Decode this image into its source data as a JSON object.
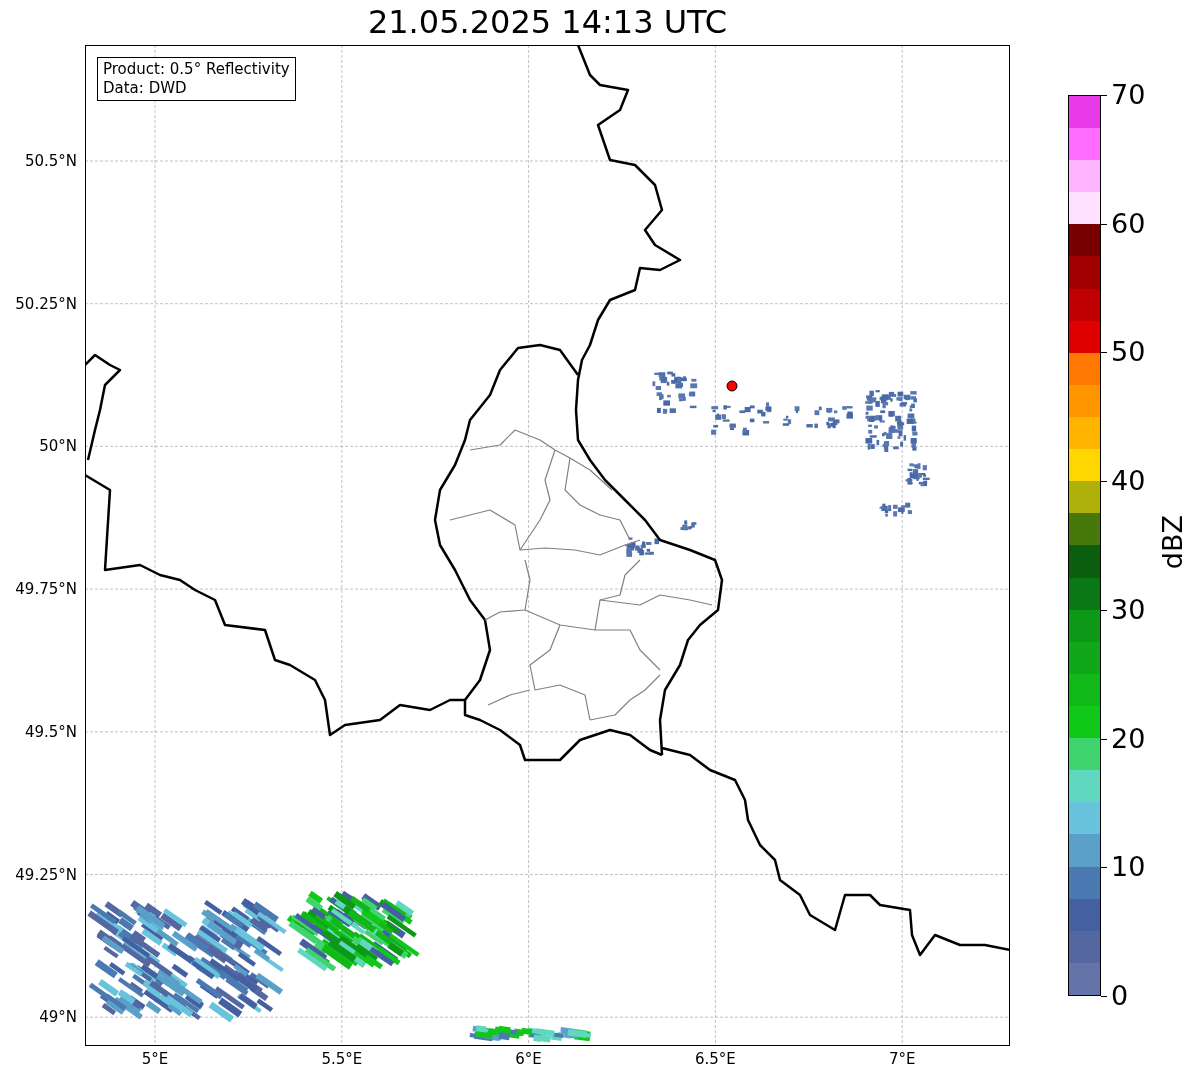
{
  "title": "21.05.2025 14:13 UTC",
  "info_box": {
    "lines": [
      "Product: 0.5° Reflectivity",
      "Data: DWD"
    ]
  },
  "map": {
    "y_ticks": [
      "50.5°N",
      "50.25°N",
      "50°N",
      "49.75°N",
      "49.5°N",
      "49.25°N",
      "49°N"
    ],
    "x_ticks": [
      "5°E",
      "5.5°E",
      "6°E",
      "6.5°E",
      "7°E"
    ]
  },
  "colorbar": {
    "label": "dBZ",
    "ticks": [
      "70",
      "60",
      "50",
      "40",
      "30",
      "20",
      "10",
      "0"
    ],
    "segments": [
      {
        "color": "#6474a8"
      },
      {
        "color": "#5567a0"
      },
      {
        "color": "#4460a0"
      },
      {
        "color": "#4b7ab3"
      },
      {
        "color": "#5aa0c8"
      },
      {
        "color": "#68c4dc"
      },
      {
        "color": "#60d8c0"
      },
      {
        "color": "#3fd46e"
      },
      {
        "color": "#10c818"
      },
      {
        "color": "#10b818"
      },
      {
        "color": "#10a818"
      },
      {
        "color": "#0e9818"
      },
      {
        "color": "#0a7814"
      },
      {
        "color": "#0a5e0e"
      },
      {
        "color": "#46780a"
      },
      {
        "color": "#b0b00a"
      },
      {
        "color": "#ffd700"
      },
      {
        "color": "#ffb400"
      },
      {
        "color": "#ff9600"
      },
      {
        "color": "#ff7800"
      },
      {
        "color": "#e00000"
      },
      {
        "color": "#c00000"
      },
      {
        "color": "#a00000"
      },
      {
        "color": "#780000"
      },
      {
        "color": "#ffe0ff"
      },
      {
        "color": "#ffb4ff"
      },
      {
        "color": "#ff6cff"
      },
      {
        "color": "#e83ae8"
      }
    ]
  }
}
